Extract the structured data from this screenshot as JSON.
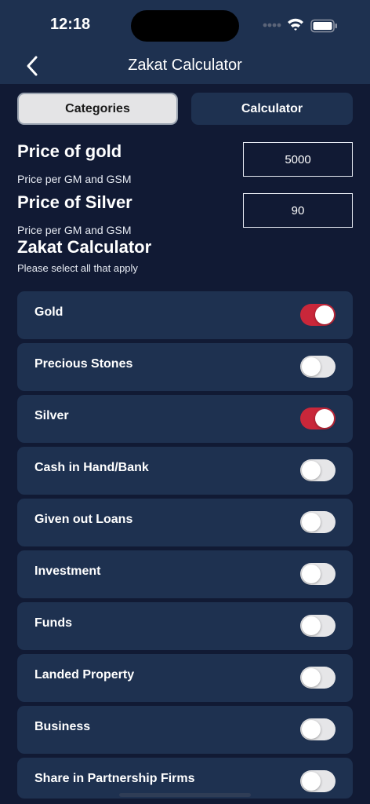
{
  "status_bar": {
    "time": "12:18"
  },
  "nav": {
    "title": "Zakat Calculator",
    "back_icon": "chevron-left-icon"
  },
  "segments": {
    "categories": "Categories",
    "calculator": "Calculator"
  },
  "gold": {
    "title": "Price of gold",
    "subtitle": "Price per GM and GSM",
    "value": "5000"
  },
  "silver": {
    "title": "Price of Silver",
    "subtitle": "Price per GM and GSM",
    "value": "90"
  },
  "section": {
    "title": "Zakat Calculator",
    "subtitle": "Please select all that apply"
  },
  "categories": [
    {
      "label": "Gold",
      "on": true
    },
    {
      "label": "Precious Stones",
      "on": false
    },
    {
      "label": "Silver",
      "on": true
    },
    {
      "label": "Cash in Hand/Bank",
      "on": false
    },
    {
      "label": "Given out Loans",
      "on": false
    },
    {
      "label": "Investment",
      "on": false
    },
    {
      "label": "Funds",
      "on": false
    },
    {
      "label": "Landed Property",
      "on": false
    },
    {
      "label": "Business",
      "on": false
    },
    {
      "label": "Share in Partnership Firms",
      "on": false
    }
  ],
  "colors": {
    "background": "#111a34",
    "card": "#1e3150",
    "toggle_on": "#c9273a",
    "toggle_off": "#e6e6e8"
  }
}
